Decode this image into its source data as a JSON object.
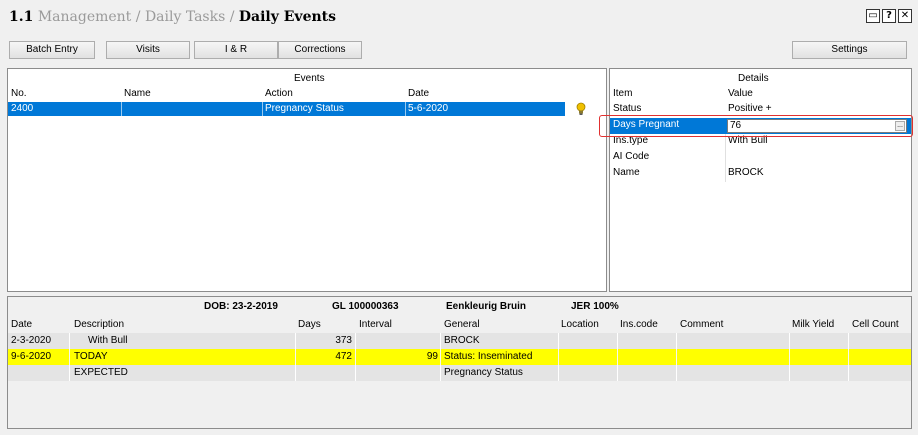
{
  "window": {
    "number": "1.1",
    "breadcrumb": [
      "Management",
      "Daily Tasks"
    ],
    "current": "Daily Events",
    "separator": "/",
    "controls": {
      "restore": "▭",
      "help": "?",
      "close": "✕"
    }
  },
  "toolbar": {
    "batch_entry": "Batch Entry",
    "visits": "Visits",
    "ir": "I & R",
    "corrections": "Corrections",
    "settings": "Settings"
  },
  "events": {
    "title": "Events",
    "columns": [
      "No.",
      "Name",
      "Action",
      "Date"
    ],
    "rows": [
      {
        "no": "2400",
        "name": "",
        "action": "Pregnancy Status",
        "date": "5-6-2020",
        "icon": "lightbulb-icon"
      }
    ]
  },
  "details": {
    "title": "Details",
    "columns": [
      "Item",
      "Value"
    ],
    "rows": [
      {
        "item": "Status",
        "value": "Positive +"
      },
      {
        "item": "Days Pregnant",
        "value": "76"
      },
      {
        "item": "Ins.type",
        "value": "With Bull"
      },
      {
        "item": "AI Code",
        "value": ""
      },
      {
        "item": "Name",
        "value": "BROCK"
      }
    ],
    "ellipsis": "..."
  },
  "history": {
    "dob": "DOB: 23-2-2019",
    "gl": "GL 100000363",
    "animal_name": "Eenkleurig Bruin",
    "breed": "JER 100%",
    "columns": [
      "Date",
      "Description",
      "Days",
      "Interval",
      "General",
      "Location",
      "Ins.code",
      "Comment",
      "Milk Yield",
      "Cell Count"
    ],
    "rows": [
      {
        "date": "2-3-2020",
        "description": "With Bull",
        "days": "373",
        "interval": "",
        "general": "BROCK",
        "style": "gray"
      },
      {
        "date": "9-6-2020",
        "description": "TODAY",
        "days": "472",
        "interval": "99",
        "general": "Status: Inseminated",
        "style": "yellow"
      },
      {
        "date": "",
        "description": "EXPECTED",
        "days": "",
        "interval": "",
        "general": "Pregnancy Status",
        "style": "gray"
      }
    ]
  },
  "colors": {
    "selection": "#0078d7",
    "today": "#ffff00",
    "highlight_box": "#e03030"
  }
}
